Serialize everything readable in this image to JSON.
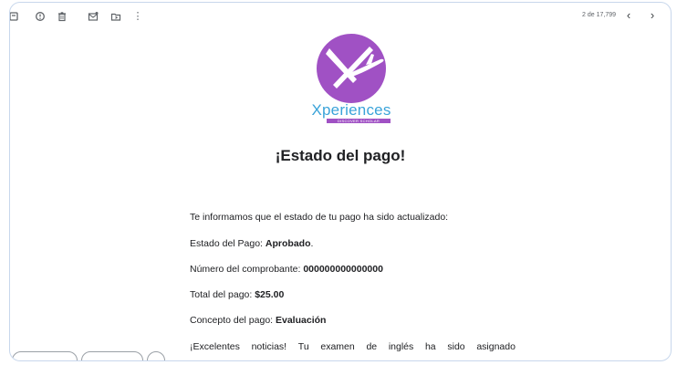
{
  "toolbar": {
    "icons": [
      "archive-icon",
      "report-spam-icon",
      "delete-icon",
      "mark-unread-icon",
      "move-to-icon",
      "more-options-icon"
    ],
    "counter": "2 de 17,799",
    "prev": "‹",
    "next": "›",
    "more": "⋮"
  },
  "email": {
    "brand_name": "Xperiences",
    "brand_tagline": "DISCOVER SCHOLAR",
    "heading": "¡Estado del pago!",
    "intro": "Te informamos que el estado de tu pago ha sido actualizado:",
    "status_label": "Estado del Pago: ",
    "status_value": "Aprobado",
    "status_period": ".",
    "voucher_label": "Número del comprobante: ",
    "voucher_value": "000000000000000",
    "total_label": "Total del pago: ",
    "total_value": "$25.00",
    "concept_label": "Concepto del pago: ",
    "concept_value": "Evaluación",
    "news_words": [
      "¡Excelentes",
      "noticias!",
      "Tu",
      "examen",
      "de",
      "inglés",
      "ha",
      "sido",
      "asignado"
    ]
  },
  "colors": {
    "brand_purple": "#a051c4",
    "brand_blue": "#3aa3d9",
    "frame_border": "#c8d7ec"
  }
}
